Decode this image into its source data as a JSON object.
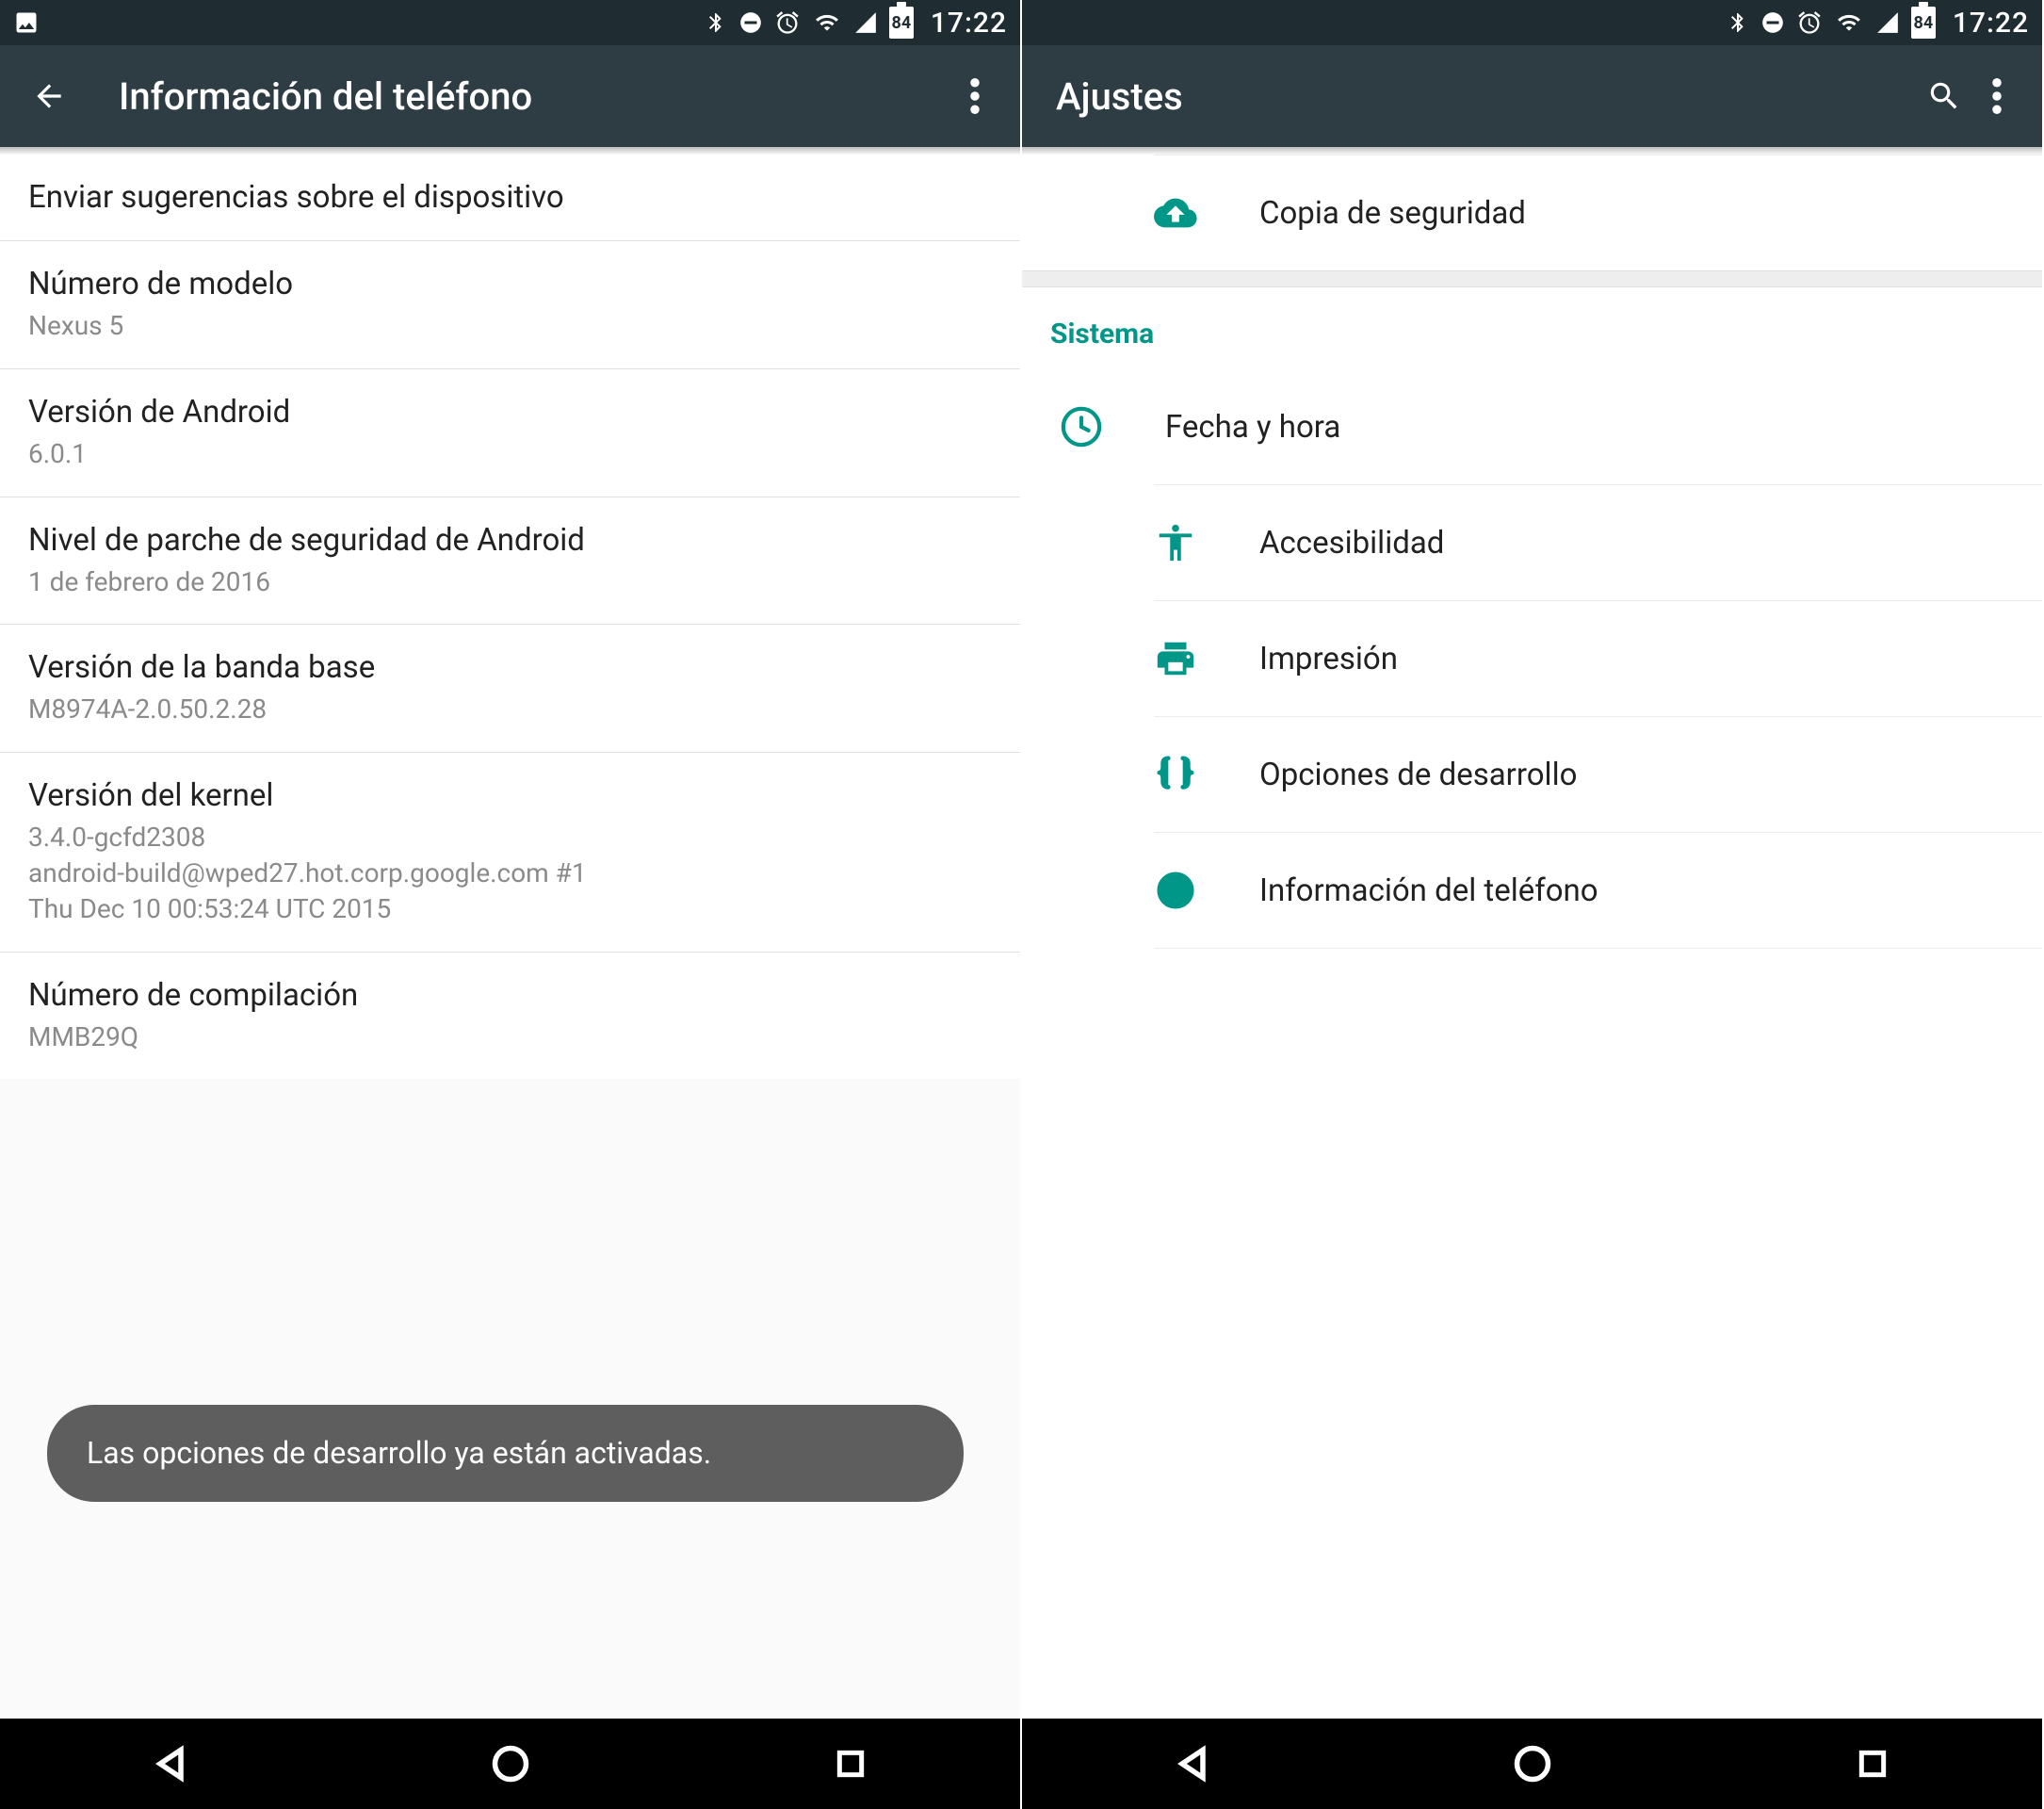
{
  "status": {
    "time": "17:22",
    "battery": "84"
  },
  "left": {
    "title": "Información del teléfono",
    "items": [
      {
        "primary": "Enviar sugerencias sobre el dispositivo",
        "secondary": ""
      },
      {
        "primary": "Número de modelo",
        "secondary": "Nexus 5"
      },
      {
        "primary": "Versión de Android",
        "secondary": "6.0.1"
      },
      {
        "primary": "Nivel de parche de seguridad de Android",
        "secondary": "1 de febrero de 2016"
      },
      {
        "primary": "Versión de la banda base",
        "secondary": "M8974A-2.0.50.2.28"
      },
      {
        "primary": "Versión del kernel",
        "secondary": "3.4.0-gcfd2308\nandroid-build@wped27.hot.corp.google.com #1\nThu Dec 10 00:53:24 UTC 2015"
      },
      {
        "primary": "Número de compilación",
        "secondary": "MMB29Q"
      }
    ],
    "toast": "Las opciones de desarrollo ya están activadas."
  },
  "right": {
    "title": "Ajustes",
    "backup": "Copia de seguridad",
    "section": "Sistema",
    "items": [
      {
        "label": "Fecha y hora",
        "icon": "clock"
      },
      {
        "label": "Accesibilidad",
        "icon": "accessibility"
      },
      {
        "label": "Impresión",
        "icon": "print"
      },
      {
        "label": "Opciones de desarrollo",
        "icon": "braces"
      },
      {
        "label": "Información del teléfono",
        "icon": "info"
      }
    ]
  }
}
